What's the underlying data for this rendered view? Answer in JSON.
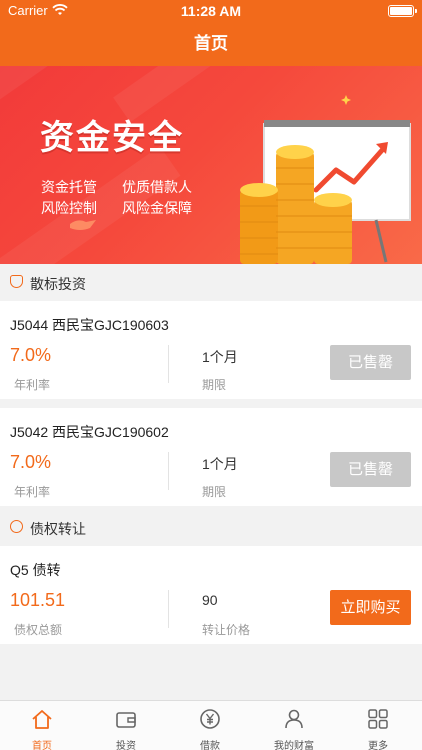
{
  "status_bar": {
    "carrier": "Carrier",
    "time": "11:28 AM"
  },
  "nav": {
    "title": "首页"
  },
  "banner": {
    "title": "资金安全",
    "features": [
      "资金托管",
      "优质借款人",
      "风险控制",
      "风险金保障"
    ]
  },
  "sections": {
    "loans": {
      "title": "散标投资"
    },
    "transfers": {
      "title": "债权转让"
    }
  },
  "loan_items": [
    {
      "name": "J5044 西民宝GJC190603",
      "rate": "7.0%",
      "rate_label": "年利率",
      "term": "1个月",
      "term_label": "期限",
      "button": "已售罄"
    },
    {
      "name": "J5042 西民宝GJC190602",
      "rate": "7.0%",
      "rate_label": "年利率",
      "term": "1个月",
      "term_label": "期限",
      "button": "已售罄"
    }
  ],
  "transfer_items": [
    {
      "name": "Q5 债转",
      "amount": "101.51",
      "amount_label": "债权总额",
      "price": "90",
      "price_label": "转让价格",
      "button": "立即购买"
    }
  ],
  "tab_bar": [
    {
      "label": "首页",
      "icon": "home-icon",
      "active": true
    },
    {
      "label": "投资",
      "icon": "wallet-icon",
      "active": false
    },
    {
      "label": "借款",
      "icon": "yuan-icon",
      "active": false
    },
    {
      "label": "我的财富",
      "icon": "user-icon",
      "active": false
    },
    {
      "label": "更多",
      "icon": "grid-icon",
      "active": false
    }
  ],
  "colors": {
    "accent": "#f26a1b",
    "sold_button": "#c8c8c8",
    "banner_red": "#f23a3a"
  }
}
